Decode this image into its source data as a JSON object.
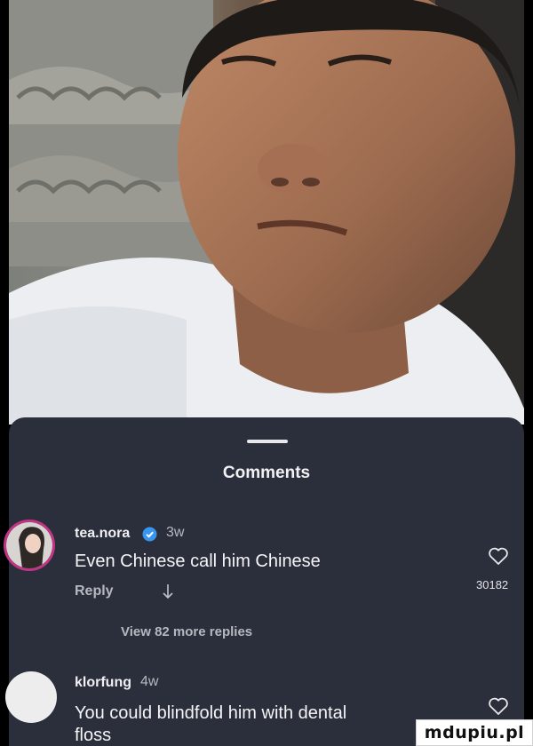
{
  "sheet": {
    "title": "Comments"
  },
  "comments": [
    {
      "username": "tea.nora",
      "verified": true,
      "time": "3w",
      "text": "Even Chinese call him Chinese",
      "reply_label": "Reply",
      "likes": "30182",
      "view_replies": "View 82 more replies"
    },
    {
      "username": "klorfung",
      "time": "4w",
      "text_line1": "You could blindfold him with dental",
      "text_line2": "floss"
    }
  ],
  "icons": {
    "verified": "verified-badge-icon",
    "heart": "heart-outline-icon",
    "reply_arrow": "arrow-down-icon"
  },
  "colors": {
    "sheet_bg": "#2b2f3b",
    "verified": "#3797f0",
    "avatar_ring": "#c13584"
  },
  "watermark": "mdupiu.pl"
}
